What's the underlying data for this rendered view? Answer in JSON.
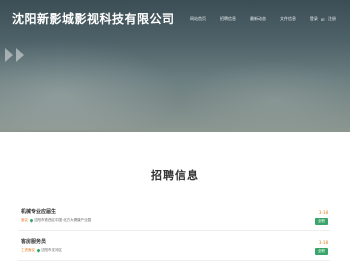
{
  "header": {
    "brand": "沈阳新影城影视科技有限公司",
    "nav": [
      "网站首页",
      "招聘信息",
      "最新动态",
      "文件信息"
    ],
    "login": "登录",
    "or": "or",
    "register": "注册"
  },
  "section": {
    "title": "招聘信息"
  },
  "jobs": [
    {
      "title": "机械专业应届生",
      "salary": "面议",
      "location": "沈阳市铁西区中国·北方大健康产业园",
      "date": "3-18",
      "badge": "全职"
    },
    {
      "title": "客房服务员",
      "salary": "工资面议",
      "location": "沈阳市沈河区",
      "date": "3-18",
      "badge": "全职"
    }
  ]
}
